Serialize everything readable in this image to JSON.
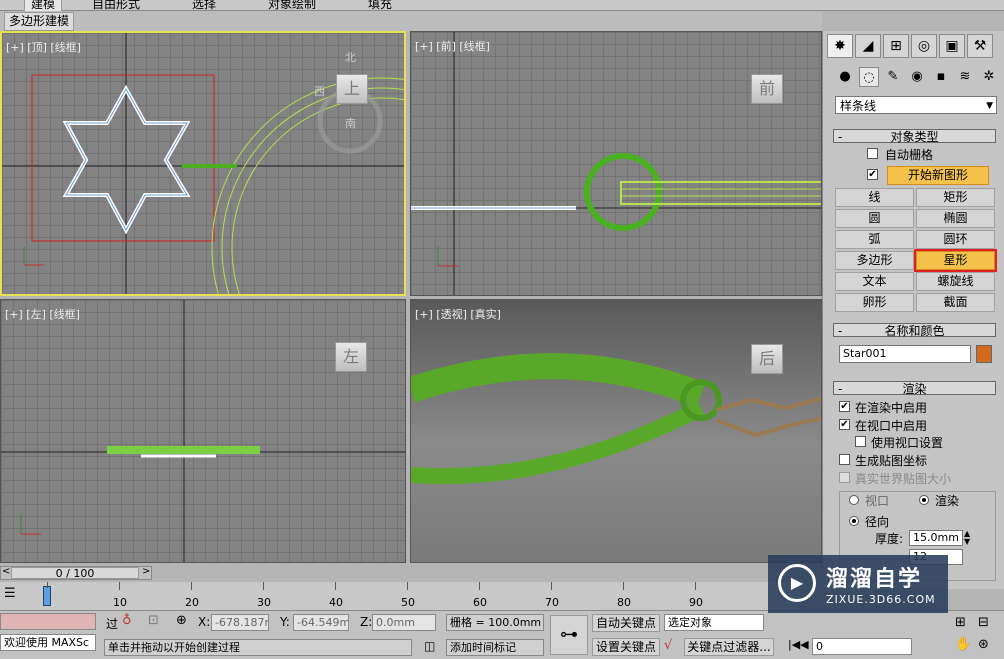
{
  "ribbon": {
    "tabs": [
      "建模",
      "自由形式",
      "选择",
      "对象绘制",
      "填充"
    ],
    "active_tab": "建模",
    "sub_tab": "多边形建模"
  },
  "viewports": {
    "top": {
      "label": "[+] [顶] [线框]",
      "cube": "上",
      "compass_n": "北",
      "compass_w": "西",
      "compass_s": "南"
    },
    "front": {
      "label": "[+] [前] [线框]",
      "cube": "前"
    },
    "left": {
      "label": "[+] [左] [线框]",
      "cube": "左"
    },
    "persp": {
      "label": "[+] [透视] [真实]",
      "cube": "后"
    }
  },
  "command_panel": {
    "dropdown": "样条线",
    "object_type": {
      "title": "对象类型",
      "auto_grid": "自动栅格",
      "start_new_shape": "开始新图形",
      "buttons": [
        "线",
        "矩形",
        "圆",
        "椭圆",
        "弧",
        "圆环",
        "多边形",
        "星形",
        "文本",
        "螺旋线",
        "卵形",
        "截面"
      ],
      "active_button": "星形"
    },
    "name_color": {
      "title": "名称和颜色",
      "name": "Star001",
      "color": "#d2691e"
    },
    "rendering": {
      "title": "渲染",
      "enable_render": "在渲染中启用",
      "enable_viewport": "在视口中启用",
      "use_viewport_settings": "使用视口设置",
      "gen_mapping": "生成贴图坐标",
      "real_world": "真实世界贴图大小",
      "viewport_radio": "视口",
      "render_radio": "渲染",
      "radial": "径向",
      "thickness_label": "厚度:",
      "thickness_value": "15.0mm",
      "sides_value": "12"
    }
  },
  "timeline": {
    "frame_display": "0 / 100",
    "ticks": [
      "10",
      "20",
      "30",
      "40",
      "50",
      "60",
      "70",
      "80",
      "90"
    ]
  },
  "status": {
    "welcome": "欢迎使用 MAXSc",
    "prompt": "单击并拖动以开始创建过程",
    "x_label": "X:",
    "x_value": "-678.187m",
    "y_label": "Y:",
    "y_value": "-64.549mm",
    "z_label": "Z:",
    "z_value": "0.0mm",
    "grid": "栅格 = 100.0mm",
    "add_time_tag": "添加时间标记",
    "auto_key": "自动关键点",
    "set_key": "设置关键点",
    "selected_object": "选定对象",
    "key_filter": "关键点过滤器...",
    "frame_field": "0"
  },
  "watermark": {
    "title": "溜溜自学",
    "url": "ZIXUE.3D66.COM"
  }
}
